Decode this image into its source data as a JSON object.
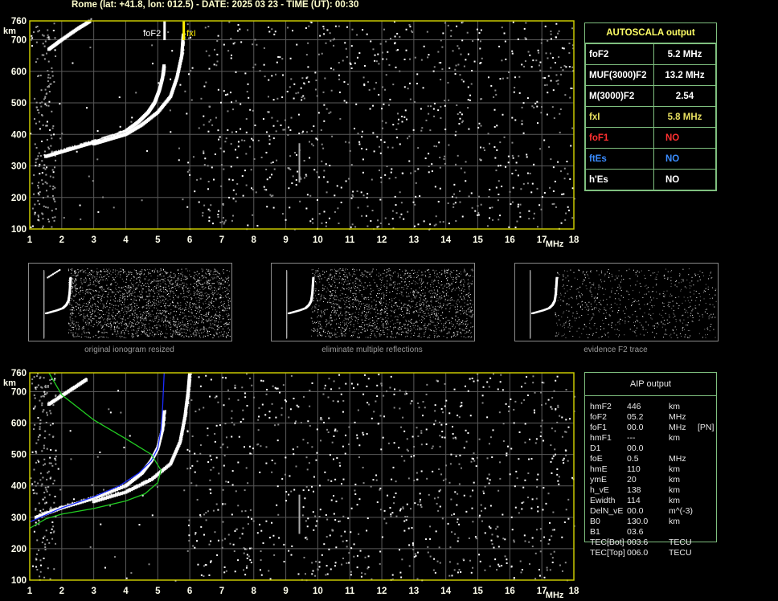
{
  "header": "Rome (lat: +41.8, lon: 012.5) - DATE: 2025 03 23 - TIME (UT): 00:30",
  "autoscala": {
    "title": "AUTOSCALA output",
    "rows": [
      {
        "label": "foF2",
        "value": "5.2 MHz",
        "color": "#ffffff"
      },
      {
        "label": "MUF(3000)F2",
        "value": "13.2 MHz",
        "color": "#ffffff"
      },
      {
        "label": "M(3000)F2",
        "value": "2.54",
        "color": "#ffffff"
      },
      {
        "label": "fxI",
        "value": "5.8 MHz",
        "color": "#e8e060"
      },
      {
        "label": "foF1",
        "value": "NO",
        "color": "#ff3030"
      },
      {
        "label": "ftEs",
        "value": "NO",
        "color": "#3a8cff"
      },
      {
        "label": "h'Es",
        "value": "NO",
        "color": "#ffffff"
      }
    ]
  },
  "aip": {
    "title": "AIP output",
    "rows": [
      {
        "name": "hmF2",
        "value": "446",
        "unit": "km",
        "extra": ""
      },
      {
        "name": "foF2",
        "value": "05.2",
        "unit": "MHz",
        "extra": ""
      },
      {
        "name": "foF1",
        "value": "00.0",
        "unit": "MHz",
        "extra": "[PN]"
      },
      {
        "name": "hmF1",
        "value": "---",
        "unit": "km",
        "extra": ""
      },
      {
        "name": "D1",
        "value": "00.0",
        "unit": "",
        "extra": ""
      },
      {
        "name": "foE",
        "value": "0.5",
        "unit": "MHz",
        "extra": ""
      },
      {
        "name": "hmE",
        "value": "110",
        "unit": "km",
        "extra": ""
      },
      {
        "name": "ymE",
        "value": "20",
        "unit": "km",
        "extra": ""
      },
      {
        "name": "h_vE",
        "value": "138",
        "unit": "km",
        "extra": ""
      },
      {
        "name": "Ewidth",
        "value": "114",
        "unit": "km",
        "extra": ""
      },
      {
        "name": "DelN_vE",
        "value": "00.0",
        "unit": "m^(-3)",
        "extra": ""
      },
      {
        "name": "B0",
        "value": "130.0",
        "unit": "km",
        "extra": ""
      },
      {
        "name": "B1",
        "value": "03.6",
        "unit": "",
        "extra": ""
      },
      {
        "name": "TEC[Bot]",
        "value": "003.6",
        "unit": "TECU",
        "extra": ""
      },
      {
        "name": "TEC[Top]",
        "value": "006.0",
        "unit": "TECU",
        "extra": ""
      }
    ]
  },
  "thumbnails": [
    {
      "caption": "original ionogram resized"
    },
    {
      "caption": "eliminate multiple reflections"
    },
    {
      "caption": "evidence F2 trace"
    }
  ],
  "chart_data": [
    {
      "type": "scatter",
      "name": "ionogram-autoscala",
      "xunit": "MHz",
      "yunit": "km",
      "xlim": [
        1,
        18
      ],
      "ylim": [
        100,
        760
      ],
      "xticks": [
        "1",
        "2",
        "3",
        "4",
        "5",
        "6",
        "7",
        "8",
        "9",
        "10",
        "11",
        "12",
        "13",
        "14",
        "15",
        "16",
        "17",
        "18"
      ],
      "yticks": [
        "760",
        "700",
        "600",
        "500",
        "400",
        "300",
        "200",
        "100"
      ],
      "grid": true,
      "markers": [
        {
          "label": "foF2",
          "x": 5.2,
          "color": "#ffffff"
        },
        {
          "label": "fxI",
          "x": 5.8,
          "color": "#ffee00"
        }
      ],
      "traces": [
        {
          "kind": "o-trace",
          "color": "#ffffff",
          "points": [
            [
              1.5,
              330
            ],
            [
              2,
              345
            ],
            [
              2.5,
              360
            ],
            [
              3,
              375
            ],
            [
              3.5,
              390
            ],
            [
              4,
              410
            ],
            [
              4.4,
              440
            ],
            [
              4.7,
              470
            ],
            [
              4.9,
              500
            ],
            [
              5.05,
              540
            ],
            [
              5.15,
              580
            ],
            [
              5.2,
              620
            ]
          ]
        },
        {
          "kind": "x-trace",
          "color": "#ffffff",
          "points": [
            [
              3,
              370
            ],
            [
              3.5,
              385
            ],
            [
              4,
              400
            ],
            [
              4.5,
              430
            ],
            [
              5,
              470
            ],
            [
              5.4,
              520
            ],
            [
              5.6,
              580
            ],
            [
              5.75,
              650
            ],
            [
              5.8,
              720
            ]
          ]
        },
        {
          "kind": "multiple",
          "color": "#ffffff",
          "points": [
            [
              1.6,
              670
            ],
            [
              2,
              700
            ],
            [
              2.5,
              735
            ],
            [
              2.9,
              760
            ]
          ]
        }
      ]
    },
    {
      "type": "scatter",
      "name": "ionogram-aip",
      "xunit": "MHz",
      "yunit": "km",
      "xlim": [
        1,
        18
      ],
      "ylim": [
        100,
        760
      ],
      "xticks": [
        "1",
        "2",
        "3",
        "4",
        "5",
        "6",
        "7",
        "8",
        "9",
        "10",
        "11",
        "12",
        "13",
        "14",
        "15",
        "16",
        "17",
        "18"
      ],
      "yticks": [
        "760",
        "700",
        "600",
        "500",
        "400",
        "300",
        "200",
        "100"
      ],
      "grid": true,
      "traces": [
        {
          "kind": "o-trace",
          "color": "#ffffff",
          "points": [
            [
              1.2,
              300
            ],
            [
              2,
              330
            ],
            [
              3,
              360
            ],
            [
              4,
              400
            ],
            [
              4.5,
              440
            ],
            [
              4.8,
              480
            ],
            [
              5,
              520
            ],
            [
              5.15,
              580
            ],
            [
              5.2,
              640
            ]
          ]
        },
        {
          "kind": "x-trace",
          "color": "#ffffff",
          "points": [
            [
              3,
              350
            ],
            [
              4,
              380
            ],
            [
              4.8,
              420
            ],
            [
              5.4,
              470
            ],
            [
              5.7,
              540
            ],
            [
              5.85,
              620
            ],
            [
              5.95,
              700
            ],
            [
              6,
              760
            ]
          ]
        },
        {
          "kind": "multiple",
          "color": "#ffffff",
          "points": [
            [
              1.6,
              660
            ],
            [
              2.2,
              700
            ],
            [
              2.8,
              740
            ]
          ]
        }
      ],
      "lines": [
        {
          "name": "virtual-height",
          "color": "#1a2cff",
          "points": [
            [
              1,
              285
            ],
            [
              2,
              330
            ],
            [
              3,
              365
            ],
            [
              3.8,
              400
            ],
            [
              4.4,
              440
            ],
            [
              4.8,
              480
            ],
            [
              5,
              520
            ],
            [
              5.1,
              580
            ],
            [
              5.15,
              650
            ],
            [
              5.2,
              760
            ]
          ]
        },
        {
          "name": "profile-true-height",
          "color": "#22cc22",
          "points": [
            [
              1,
              265
            ],
            [
              1.5,
              295
            ],
            [
              2,
              310
            ],
            [
              3,
              328
            ],
            [
              4,
              352
            ],
            [
              4.6,
              375
            ],
            [
              5,
              410
            ],
            [
              5.1,
              450
            ],
            [
              4.8,
              500
            ],
            [
              4,
              550
            ],
            [
              3,
              610
            ],
            [
              2,
              690
            ],
            [
              1.6,
              760
            ]
          ]
        }
      ]
    }
  ]
}
